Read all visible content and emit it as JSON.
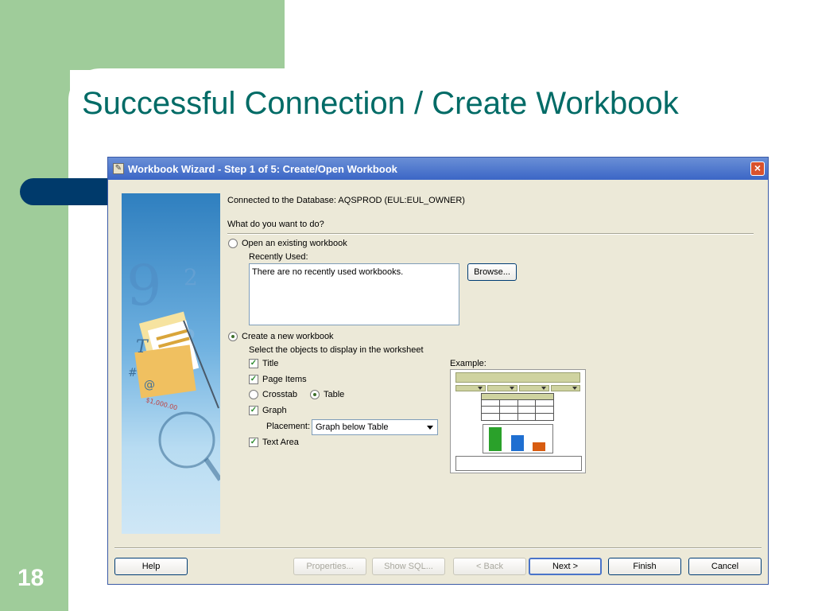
{
  "slide": {
    "title": "Successful Connection / Create Workbook",
    "number": "18"
  },
  "dialog": {
    "title": "Workbook Wizard - Step 1 of 5: Create/Open Workbook",
    "connected_text": "Connected to the Database: AQSPROD (EUL:EUL_OWNER)",
    "question": "What do you want to do?",
    "open_existing": {
      "label": "Open an existing workbook",
      "checked": false,
      "recently_used_label": "Recently Used:",
      "recently_used_empty": "There are no recently used workbooks.",
      "browse_label": "Browse..."
    },
    "create_new": {
      "label": "Create a new workbook",
      "checked": true,
      "select_objects_label": "Select the objects to display in the worksheet",
      "title_label": "Title",
      "title_checked": true,
      "page_items_label": "Page Items",
      "page_items_checked": true,
      "crosstab_label": "Crosstab",
      "crosstab_checked": false,
      "table_label": "Table",
      "table_checked": true,
      "graph_label": "Graph",
      "graph_checked": true,
      "placement_label": "Placement:",
      "placement_value": "Graph below Table",
      "text_area_label": "Text Area",
      "text_area_checked": true
    },
    "example_label": "Example:",
    "example_colors": {
      "header": "#cfd3a0",
      "bar1": "#2aa12a",
      "bar2": "#1f6fd1",
      "bar3": "#d85c10"
    },
    "buttons": {
      "help": "Help",
      "properties": "Properties...",
      "show_sql": "Show SQL...",
      "back": "< Back",
      "next": "Next >",
      "finish": "Finish",
      "cancel": "Cancel"
    }
  }
}
